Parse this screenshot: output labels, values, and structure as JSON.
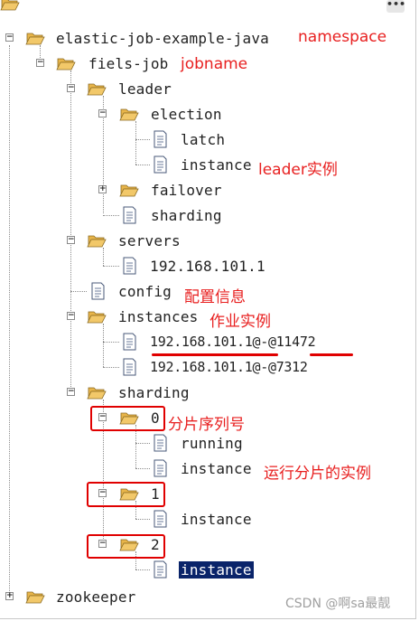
{
  "toolbar": {
    "menu_label": "•••"
  },
  "tree": {
    "root_label": "elastic-job-example-java",
    "job_label": "fiels-job",
    "leader_label": "leader",
    "election_label": "election",
    "latch_label": "latch",
    "election_instance_label": "instance",
    "failover_label": "failover",
    "leader_sharding_label": "sharding",
    "servers_label": "servers",
    "server_ip_label": "192.168.101.1",
    "config_label": "config",
    "instances_label": "instances",
    "instance1_label": "192.168.101.1@-@11472",
    "instance2_label": "192.168.101.1@-@7312",
    "sharding_label": "sharding",
    "shard0_label": "0",
    "shard0_running_label": "running",
    "shard0_instance_label": "instance",
    "shard1_label": "1",
    "shard1_instance_label": "instance",
    "shard2_label": "2",
    "shard2_instance_label": "instance",
    "zookeeper_label": "zookeeper"
  },
  "annotations": {
    "namespace": "namespace",
    "jobname": "jobname",
    "leader_instance": "leader实例",
    "config_info": "配置信息",
    "job_instance": "作业实例",
    "shard_seq": "分片序列号",
    "running_shard_instance": "运行分片的实例"
  },
  "watermark": "CSDN @啊sa最靓",
  "colors": {
    "annotation": "#e82020",
    "selection": "#0a246a",
    "folder": "#f2c869"
  }
}
